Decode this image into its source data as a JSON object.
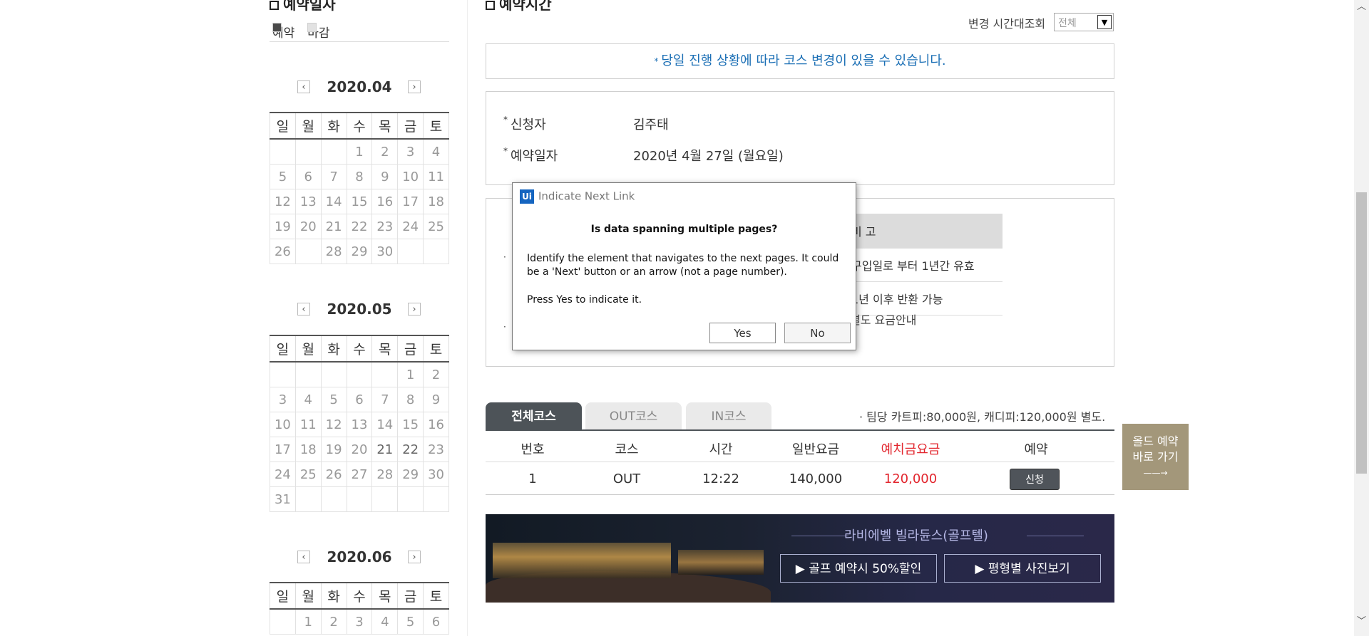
{
  "left": {
    "title": "예약일자",
    "legend": [
      {
        "label": "예약"
      },
      {
        "label": "마감"
      }
    ],
    "calendars": [
      {
        "month": "2020.04",
        "weekdays": [
          "일",
          "월",
          "화",
          "수",
          "목",
          "금",
          "토"
        ],
        "rows": [
          [
            "",
            "",
            "",
            "1",
            "2",
            "3",
            "4"
          ],
          [
            "5",
            "6",
            "7",
            "8",
            "9",
            "10",
            "11"
          ],
          [
            "12",
            "13",
            "14",
            "15",
            "16",
            "17",
            "18"
          ],
          [
            "19",
            "20",
            "21",
            "22",
            "23",
            "24",
            "25"
          ],
          [
            "26",
            "27",
            "28",
            "29",
            "30",
            "",
            ""
          ]
        ]
      },
      {
        "month": "2020.05",
        "weekdays": [
          "일",
          "월",
          "화",
          "수",
          "목",
          "금",
          "토"
        ],
        "rows": [
          [
            "",
            "",
            "",
            "",
            "",
            "1",
            "2"
          ],
          [
            "3",
            "4",
            "5",
            "6",
            "7",
            "8",
            "9"
          ],
          [
            "10",
            "11",
            "12",
            "13",
            "14",
            "15",
            "16"
          ],
          [
            "17",
            "18",
            "19",
            "20",
            "21",
            "22",
            "23"
          ],
          [
            "24",
            "25",
            "26",
            "27",
            "28",
            "29",
            "30"
          ],
          [
            "31",
            "",
            "",
            "",
            "",
            "",
            ""
          ]
        ]
      },
      {
        "month": "2020.06",
        "weekdays": [
          "일",
          "월",
          "화",
          "수",
          "목",
          "금",
          "토"
        ],
        "rows": [
          [
            "",
            "1",
            "2",
            "3",
            "4",
            "5",
            "6"
          ]
        ]
      }
    ]
  },
  "right": {
    "title": "예약시간",
    "filter_label": "변경 시간대조회",
    "filter_value": "전체",
    "notice": "당일 진행 상황에 따라 코스 변경이 있을 수 있습니다.",
    "applicant_label": "신청자",
    "applicant_value": "김주태",
    "date_label": "예약일자",
    "date_value": "2020년 4월 27일 (월요일)",
    "fee_table": {
      "header": "비 고",
      "rows": [
        "구입일로 부터 1년간 유효",
        "1년 이후 반환 가능"
      ],
      "note": "별도 요금안내"
    },
    "tabs": [
      "전체코스",
      "OUT코스",
      "IN코스"
    ],
    "tip": "· 팀당 카트피:80,000원, 캐디피:120,000원 별도.",
    "columns": [
      "번호",
      "코스",
      "시간",
      "일반요금",
      "예치금요금",
      "예약"
    ],
    "rows": [
      {
        "no": "1",
        "course": "OUT",
        "time": "12:22",
        "normal": "140,000",
        "deposit": "120,000",
        "action": "신청"
      }
    ],
    "banner": {
      "title": "라비에벨 빌라듄스(골프텔)",
      "btn1": "▶ 골프 예약시 50%할인",
      "btn2": "▶ 평형별 사진보기"
    },
    "side_button": {
      "line1": "올드 예약",
      "line2": "바로 가기",
      "arrow": "——→"
    }
  },
  "dialog": {
    "logo": "Ui",
    "title": "Indicate Next Link",
    "question": "Is data spanning multiple pages?",
    "body": "Identify the element that navigates to the next pages. It could be a 'Next' button or an arrow (not a page number).",
    "press": "Press Yes to indicate it.",
    "yes": "Yes",
    "no": "No"
  },
  "colors": {
    "accent_orange": "#f07f37",
    "closed_gray": "#5a5a5a",
    "sunday_red": "#d6202a",
    "saturday_blue": "#1b8ad3",
    "notice_blue": "#1b6fb5",
    "deposit_red": "#e2262e",
    "side_button_gold": "#a3977a"
  }
}
